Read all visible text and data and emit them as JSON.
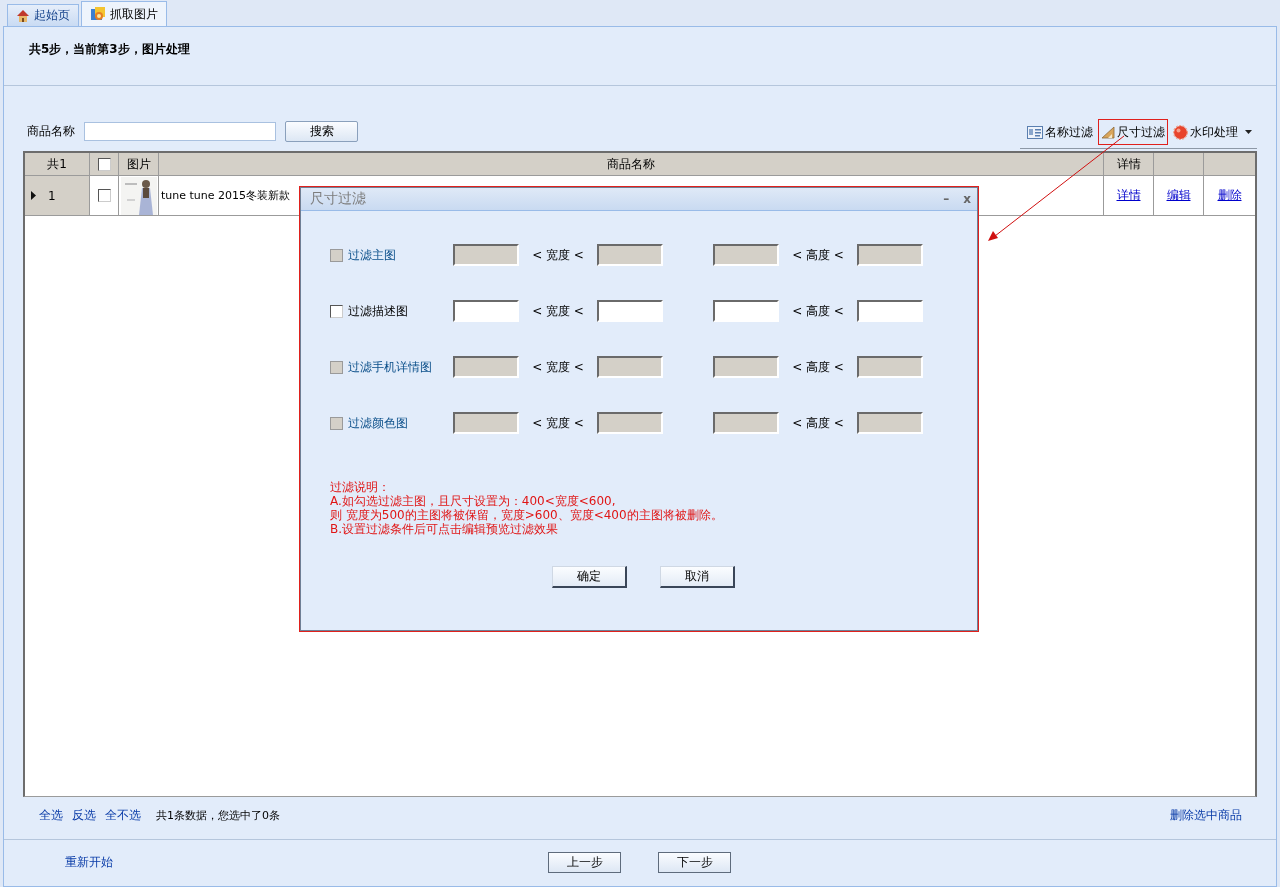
{
  "tabs": [
    {
      "label": "起始页",
      "kind": "home",
      "selected": false
    },
    {
      "label": "抓取图片",
      "selected": true
    }
  ],
  "step_text": "共5步，当前第3步，图片处理",
  "search": {
    "label": "商品名称",
    "button": "搜索"
  },
  "toolbar": [
    {
      "label": "名称过滤",
      "kind": "card",
      "highlighted": false,
      "dropdown": false
    },
    {
      "label": "尺寸过滤",
      "kind": "ruler",
      "highlighted": true,
      "dropdown": false
    },
    {
      "label": "水印处理",
      "kind": "stamp",
      "highlighted": false,
      "dropdown": true
    }
  ],
  "table": {
    "columns": [
      {
        "kind": "text",
        "label": "共1"
      },
      {
        "kind": "check",
        "checked": false
      },
      {
        "kind": "text",
        "label": "图片"
      },
      {
        "kind": "text",
        "label": "商品名称"
      },
      {
        "kind": "text",
        "label": "详情"
      },
      {
        "kind": "blank"
      },
      {
        "kind": "blank"
      }
    ],
    "rows": [
      {
        "current": true,
        "index": "1",
        "checked": false,
        "picture": {
          "kind": "picture"
        },
        "name": "tune tune 2015冬装新款",
        "links": [
          "详情",
          "编辑",
          "删除"
        ]
      }
    ]
  },
  "footer": {
    "select_links": [
      "全选",
      "反选",
      "全不选"
    ],
    "summary": "共1条数据，您选中了0条",
    "delete_link": "删除选中商品",
    "restart_link": "重新开始",
    "nav_buttons": [
      "上一步",
      "下一步"
    ]
  },
  "dialog": {
    "title": "尺寸过滤",
    "minimize": "–",
    "close": "x",
    "rows": [
      {
        "label": "过滤主图",
        "checked": false,
        "disabled": true,
        "width_op": "< 宽度 <",
        "height_op": "< 高度 <"
      },
      {
        "label": "过滤描述图",
        "checked": false,
        "disabled": false,
        "width_op": "< 宽度 <",
        "height_op": "< 高度 <"
      },
      {
        "label": "过滤手机详情图",
        "checked": false,
        "disabled": true,
        "width_op": "< 宽度 <",
        "height_op": "< 高度 <"
      },
      {
        "label": "过滤颜色图",
        "checked": false,
        "disabled": true,
        "width_op": "< 宽度 <",
        "height_op": "< 高度 <"
      }
    ],
    "notes": [
      "过滤说明：",
      "A.如勾选过滤主图，且尺寸设置为：400<宽度<600,",
      "则 宽度为500的主图将被保留，宽度>600、宽度<400的主图将被删除。",
      "B.设置过滤条件后可点击编辑预览过滤效果"
    ],
    "buttons": [
      "确定",
      "取消"
    ]
  }
}
